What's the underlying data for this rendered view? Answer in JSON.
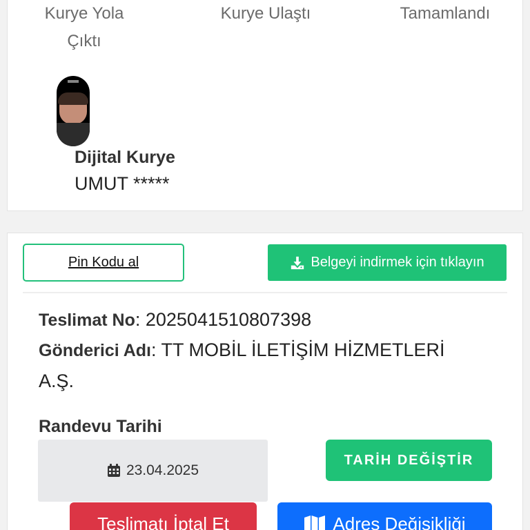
{
  "tracker": {
    "steps": [
      "Kurye Yola Çıktı",
      "Kurye Ulaştı",
      "Tamamlandı"
    ],
    "courier_label": "Dijital Kurye",
    "courier_name": "UMUT *****"
  },
  "actions": {
    "pin_label": "Pin Kodu al",
    "download_label": "Belgeyi indirmek için tıklayın",
    "download_icon": "download-icon"
  },
  "delivery": {
    "no_label": "Teslimat No",
    "no_value": "2025041510807398",
    "sender_label": "Gönderici Adı",
    "sender_value": "TT MOBİL İLETİŞİM HİZMETLERİ A.Ş."
  },
  "appointment": {
    "label": "Randevu Tarihi",
    "date": "23.04.2025",
    "date_icon": "calendar-icon",
    "change_label": "TARİH DEĞİŞTİR",
    "cancel_label": "Teslimatı İptal Et",
    "address_label": "Adres Değişikliği",
    "address_icon": "map-icon"
  },
  "colors": {
    "green": "#1fc277",
    "red": "#dc3545",
    "blue": "#0d6efd"
  }
}
